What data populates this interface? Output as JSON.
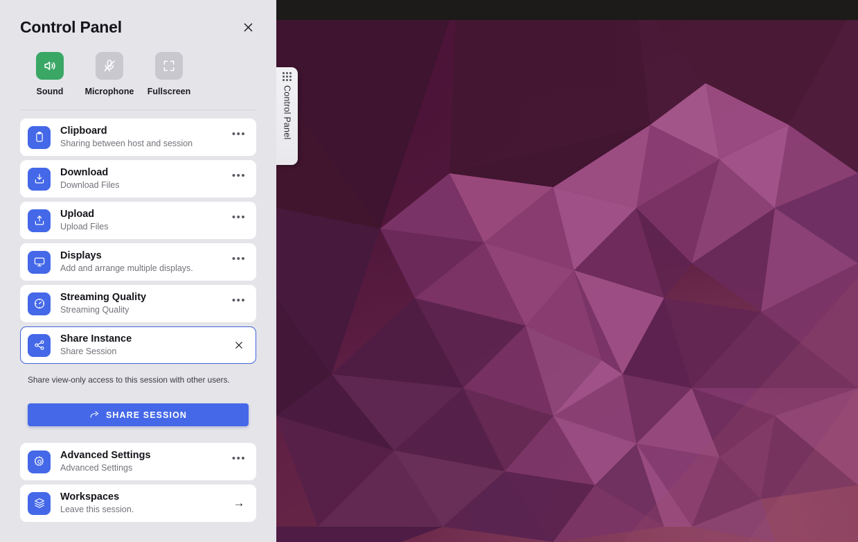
{
  "panel": {
    "title": "Control Panel",
    "close_icon": "close-icon",
    "toggles": [
      {
        "label": "Sound",
        "icon": "speaker-on-icon",
        "state": "on"
      },
      {
        "label": "Microphone",
        "icon": "microphone-off-icon",
        "state": "off"
      },
      {
        "label": "Fullscreen",
        "icon": "fullscreen-icon",
        "state": "off"
      }
    ],
    "items": [
      {
        "title": "Clipboard",
        "subtitle": "Sharing between host and session",
        "icon": "clipboard-icon",
        "action": "more-options",
        "active": false
      },
      {
        "title": "Download",
        "subtitle": "Download Files",
        "icon": "download-icon",
        "action": "more-options",
        "active": false
      },
      {
        "title": "Upload",
        "subtitle": "Upload Files",
        "icon": "upload-icon",
        "action": "more-options",
        "active": false
      },
      {
        "title": "Displays",
        "subtitle": "Add and arrange multiple displays.",
        "icon": "monitor-icon",
        "action": "more-options",
        "active": false
      },
      {
        "title": "Streaming Quality",
        "subtitle": "Streaming Quality",
        "icon": "gauge-icon",
        "action": "more-options",
        "active": false
      },
      {
        "title": "Share Instance",
        "subtitle": "Share Session",
        "icon": "share-nodes-icon",
        "action": "close",
        "active": true
      }
    ],
    "share": {
      "note": "Share view-only access to this session with other users.",
      "button_label": "SHARE SESSION",
      "button_icon": "share-arrow-icon"
    },
    "bottom_items": [
      {
        "title": "Advanced Settings",
        "subtitle": "Advanced Settings",
        "icon": "gear-icon",
        "action": "more-options"
      },
      {
        "title": "Workspaces",
        "subtitle": "Leave this session.",
        "icon": "layers-icon",
        "action": "arrow-right"
      }
    ],
    "more_glyph": "•••",
    "arrow_glyph": "→"
  },
  "handle": {
    "label": "Control Panel",
    "grip_icon": "grid-dots-icon"
  },
  "desktop": {
    "topbar_color": "#1c1b1a",
    "wallpaper_name": "ubuntu-low-poly-wallpaper"
  },
  "colors": {
    "accent_blue": "#4468e8",
    "accent_green": "#3aa765",
    "panel_bg": "#e5e4e9",
    "card_bg": "#ffffff",
    "toggle_off": "#c9c8ce",
    "active_border": "#3f63d8"
  }
}
